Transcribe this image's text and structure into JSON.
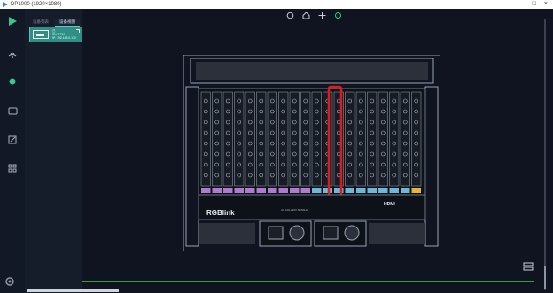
{
  "window": {
    "title": "DP1000 (1920×1080)",
    "minimize": "–",
    "maximize": "□",
    "close": "×"
  },
  "colors": {
    "accent": "#5fc7c0",
    "selection": "#e01a1a",
    "status": "#35c98a",
    "bg": "#0f1420"
  },
  "panel": {
    "tabs": [
      {
        "label": "设备列表"
      },
      {
        "label": "设备视图"
      }
    ],
    "device": {
      "line1": "已",
      "line2": "IP: 192.168.0.170",
      "line3": "SN: 1234"
    }
  },
  "rack": {
    "brand": "RGBlink",
    "badge": "HDMI",
    "ports": "AC 100-240V  50/60Hz"
  },
  "icons": [
    "play-icon",
    "network-icon",
    "status-dot-icon",
    "monitor-icon",
    "edit-icon",
    "grid-icon",
    "settings-icon",
    "refresh-icon",
    "home-icon",
    "move-icon",
    "circle-icon"
  ]
}
